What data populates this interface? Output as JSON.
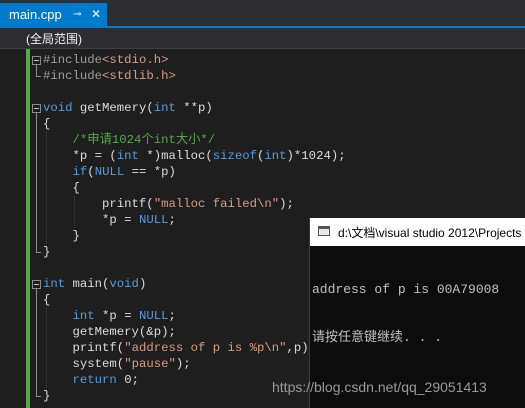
{
  "tab": {
    "title": "main.cpp",
    "pin_glyph": "⊸",
    "close_glyph": "✕"
  },
  "scope": {
    "label": "(全局范围)"
  },
  "code_lines": [
    {
      "tokens": [
        {
          "t": "#include",
          "c": "inc"
        },
        {
          "t": "<stdio.h>",
          "c": "str"
        }
      ]
    },
    {
      "tokens": [
        {
          "t": "#include",
          "c": "inc"
        },
        {
          "t": "<stdlib.h>",
          "c": "str"
        }
      ]
    },
    {
      "tokens": []
    },
    {
      "tokens": [
        {
          "t": "void",
          "c": "kw"
        },
        {
          "t": " getMemery(",
          "c": ""
        },
        {
          "t": "int",
          "c": "kw"
        },
        {
          "t": " **p)",
          "c": ""
        }
      ]
    },
    {
      "tokens": [
        {
          "t": "{",
          "c": ""
        }
      ]
    },
    {
      "tokens": [
        {
          "t": "    ",
          "c": ""
        },
        {
          "t": "/*申请1024个int大小*/",
          "c": "cmt"
        }
      ]
    },
    {
      "tokens": [
        {
          "t": "    *p = (",
          "c": ""
        },
        {
          "t": "int",
          "c": "kw"
        },
        {
          "t": " *)malloc(",
          "c": ""
        },
        {
          "t": "sizeof",
          "c": "kw"
        },
        {
          "t": "(",
          "c": ""
        },
        {
          "t": "int",
          "c": "kw"
        },
        {
          "t": ")*1024);",
          "c": ""
        }
      ]
    },
    {
      "tokens": [
        {
          "t": "    ",
          "c": ""
        },
        {
          "t": "if",
          "c": "kw"
        },
        {
          "t": "(",
          "c": ""
        },
        {
          "t": "NULL",
          "c": "kw"
        },
        {
          "t": " == *p)",
          "c": ""
        }
      ]
    },
    {
      "tokens": [
        {
          "t": "    {",
          "c": ""
        }
      ]
    },
    {
      "tokens": [
        {
          "t": "        printf(",
          "c": ""
        },
        {
          "t": "\"malloc failed\\n\"",
          "c": "str"
        },
        {
          "t": ");",
          "c": ""
        }
      ]
    },
    {
      "tokens": [
        {
          "t": "        *p = ",
          "c": ""
        },
        {
          "t": "NULL",
          "c": "kw"
        },
        {
          "t": ";",
          "c": ""
        }
      ]
    },
    {
      "tokens": [
        {
          "t": "    }",
          "c": ""
        }
      ]
    },
    {
      "tokens": [
        {
          "t": "}",
          "c": ""
        }
      ]
    },
    {
      "tokens": []
    },
    {
      "tokens": [
        {
          "t": "int",
          "c": "kw"
        },
        {
          "t": " main(",
          "c": ""
        },
        {
          "t": "void",
          "c": "kw"
        },
        {
          "t": ")",
          "c": ""
        }
      ]
    },
    {
      "tokens": [
        {
          "t": "{",
          "c": ""
        }
      ]
    },
    {
      "tokens": [
        {
          "t": "    ",
          "c": ""
        },
        {
          "t": "int",
          "c": "kw"
        },
        {
          "t": " *p = ",
          "c": ""
        },
        {
          "t": "NULL",
          "c": "kw"
        },
        {
          "t": ";",
          "c": ""
        }
      ]
    },
    {
      "tokens": [
        {
          "t": "    getMemery(&p);",
          "c": ""
        }
      ]
    },
    {
      "tokens": [
        {
          "t": "    printf(",
          "c": ""
        },
        {
          "t": "\"address of p is %p\\n\"",
          "c": "str"
        },
        {
          "t": ",p);",
          "c": ""
        }
      ]
    },
    {
      "tokens": [
        {
          "t": "    system(",
          "c": ""
        },
        {
          "t": "\"pause\"",
          "c": "str"
        },
        {
          "t": ");",
          "c": ""
        }
      ]
    },
    {
      "tokens": [
        {
          "t": "    ",
          "c": ""
        },
        {
          "t": "return",
          "c": "kw"
        },
        {
          "t": " 0;",
          "c": ""
        }
      ]
    },
    {
      "tokens": [
        {
          "t": "}",
          "c": ""
        }
      ]
    }
  ],
  "console": {
    "title": "d:\\文档\\visual studio 2012\\Projects",
    "lines": [
      "address of p is 00A79008",
      "请按任意键继续. . ."
    ]
  },
  "watermark": "https://blog.csdn.net/qq_29051413"
}
